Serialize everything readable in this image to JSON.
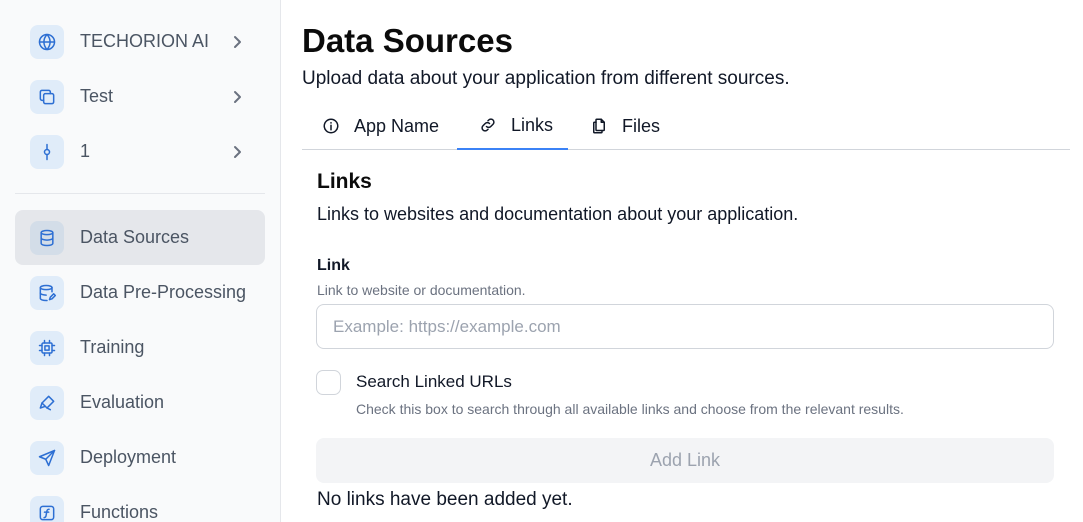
{
  "sidebar": {
    "top_items": [
      {
        "label": "TECHORION AI",
        "icon": "globe-icon"
      },
      {
        "label": "Test",
        "icon": "copy-icon"
      },
      {
        "label": "1",
        "icon": "commit-icon"
      }
    ],
    "nav_items": [
      {
        "label": "Data Sources",
        "icon": "database-icon",
        "active": true
      },
      {
        "label": "Data Pre-Processing",
        "icon": "database-edit-icon"
      },
      {
        "label": "Training",
        "icon": "chip-icon"
      },
      {
        "label": "Evaluation",
        "icon": "brush-icon"
      },
      {
        "label": "Deployment",
        "icon": "send-icon"
      },
      {
        "label": "Functions",
        "icon": "function-icon"
      }
    ]
  },
  "header": {
    "title": "Data Sources",
    "subtitle": "Upload data about your application from different sources."
  },
  "tabs": [
    {
      "label": "App Name",
      "icon": "info-icon"
    },
    {
      "label": "Links",
      "icon": "link-icon",
      "active": true
    },
    {
      "label": "Files",
      "icon": "files-icon"
    }
  ],
  "links_section": {
    "title": "Links",
    "description": "Links to websites and documentation about your application.",
    "field_label": "Link",
    "field_help": "Link to website or documentation.",
    "input_placeholder": "Example: https://example.com",
    "input_value": "",
    "checkbox_label": "Search Linked URLs",
    "checkbox_help": "Check this box to search through all available links and choose from the relevant results.",
    "checkbox_checked": false,
    "add_button_label": "Add Link",
    "empty_state": "No links have been added yet."
  },
  "colors": {
    "accent": "#3b82f6",
    "icon_blue": "#2d6fd3",
    "icon_bg": "#e0ecf9",
    "active_bg": "#e5e7eb"
  }
}
